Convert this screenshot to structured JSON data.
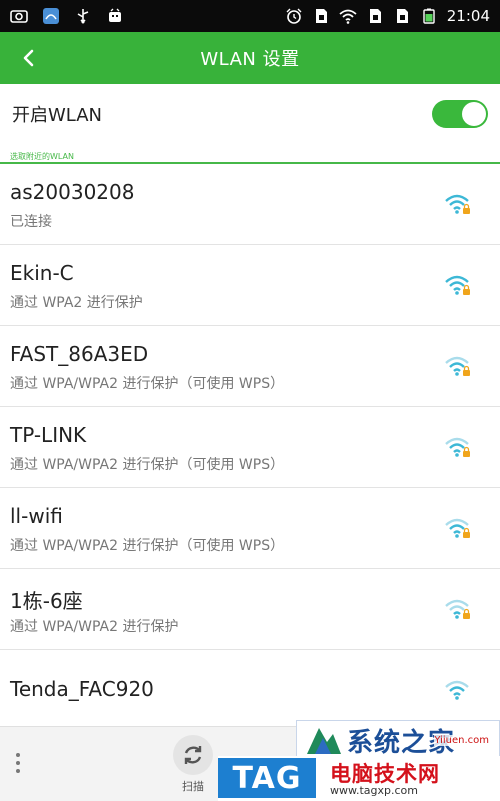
{
  "status_bar": {
    "time": "21:04",
    "icons_left": [
      "screenshot-icon",
      "app-icon",
      "usb-icon",
      "android-debug-icon"
    ],
    "icons_right": [
      "alarm-icon",
      "sim-icon",
      "wifi-icon",
      "sim2-icon",
      "sim3-icon",
      "battery-icon"
    ]
  },
  "header": {
    "title": "WLAN 设置",
    "back_icon": "chevron-left-icon"
  },
  "wlan_toggle": {
    "label": "开启WLAN",
    "state": "on"
  },
  "section_label": "选取附近的WLAN",
  "networks": [
    {
      "name": "as20030208",
      "status": "已连接",
      "secured": true
    },
    {
      "name": "Ekin-C",
      "status": "通过 WPA2 进行保护",
      "secured": true
    },
    {
      "name": "FAST_86A3ED",
      "status": "通过 WPA/WPA2 进行保护（可使用 WPS）",
      "secured": true
    },
    {
      "name": "TP-LINK",
      "status": "通过 WPA/WPA2 进行保护（可使用 WPS）",
      "secured": true
    },
    {
      "name": "ll-wifi",
      "status": "通过 WPA/WPA2 进行保护（可使用 WPS）",
      "secured": true
    },
    {
      "name": "1栋-6座",
      "status": "通过 WPA/WPA2 进行保护",
      "secured": true
    },
    {
      "name": "Tenda_FAC920",
      "status": "",
      "secured": false
    }
  ],
  "bottom_bar": {
    "scan_label": "扫描"
  },
  "watermark": {
    "site_title": "系统之家",
    "site_small": "Yiiuen.com",
    "tag": "TAG",
    "cn_name": "电脑技术网",
    "url": "www.tagxp.com"
  },
  "colors": {
    "accent": "#38b23a",
    "wifi": "#3db8d6",
    "lock": "#f0a51c"
  }
}
